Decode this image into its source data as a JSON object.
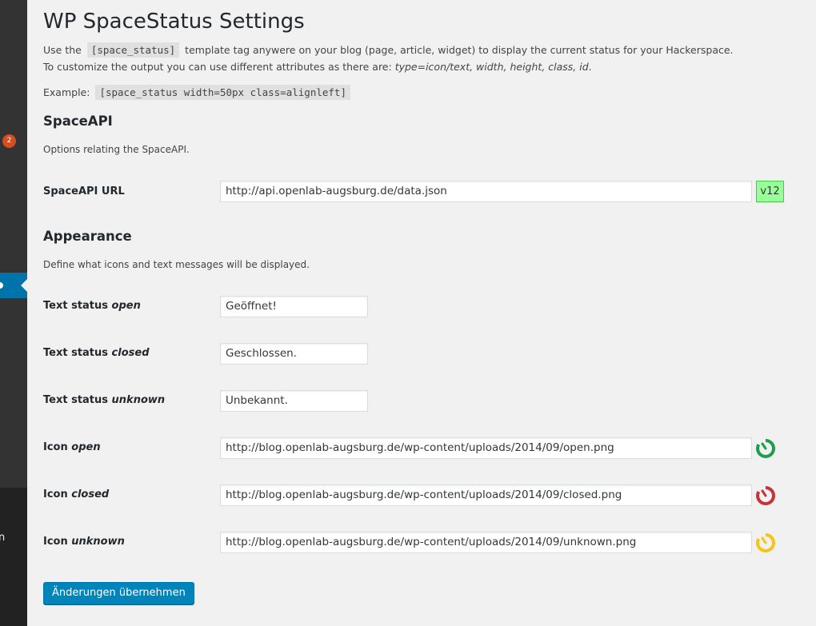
{
  "sidebar": {
    "badge_count": "2",
    "cut_label": "en"
  },
  "page": {
    "title": "WP SpaceStatus Settings",
    "intro": {
      "line1_prefix": "Use the",
      "line1_code": "[space_status]",
      "line1_suffix": "template tag anywere on your blog (page, article, widget) to display the current status for your Hackerspace.",
      "line2_prefix": "To customize the output you can use different attributes as there are: ",
      "line2_attrs": "type=icon/text, width, height, class, id",
      "line2_suffix": ".",
      "example_label": "Example:",
      "example_code": "[space_status width=50px class=alignleft]"
    }
  },
  "spaceapi": {
    "heading": "SpaceAPI",
    "description": "Options relating the SpaceAPI.",
    "url_label": "SpaceAPI URL",
    "url_value": "http://api.openlab-augsburg.de/data.json",
    "version_badge": "v12",
    "version_color": "#99ff99"
  },
  "appearance": {
    "heading": "Appearance",
    "description": "Define what icons and text messages will be displayed.",
    "fields": {
      "text_open": {
        "label_main": "Text status",
        "label_em": "open",
        "value": "Geöffnet!"
      },
      "text_closed": {
        "label_main": "Text status",
        "label_em": "closed",
        "value": "Geschlossen."
      },
      "text_unknown": {
        "label_main": "Text status",
        "label_em": "unknown",
        "value": "Unbekannt."
      },
      "icon_open": {
        "label_main": "Icon",
        "label_em": "open",
        "value": "http://blog.openlab-augsburg.de/wp-content/uploads/2014/09/open.png",
        "icon": "status-open-icon",
        "color": "#1aa04a"
      },
      "icon_closed": {
        "label_main": "Icon",
        "label_em": "closed",
        "value": "http://blog.openlab-augsburg.de/wp-content/uploads/2014/09/closed.png",
        "icon": "status-closed-icon",
        "color": "#c6343a"
      },
      "icon_unknown": {
        "label_main": "Icon",
        "label_em": "unknown",
        "value": "http://blog.openlab-augsburg.de/wp-content/uploads/2014/09/unknown.png",
        "icon": "status-unknown-icon",
        "color": "#f5c514"
      }
    }
  },
  "actions": {
    "submit_label": "Änderungen übernehmen",
    "accent": "#0085ba"
  }
}
